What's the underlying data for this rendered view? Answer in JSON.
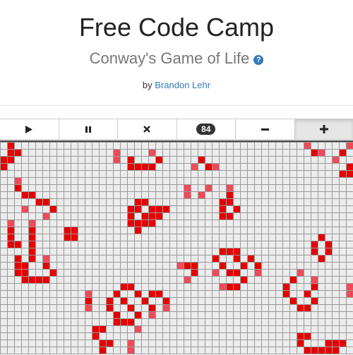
{
  "header": {
    "title": "Free Code Camp",
    "subtitle": "Conway's Game of Life",
    "help_icon": "question-circle-icon",
    "by_label": "by",
    "author": "Brandon Lehr"
  },
  "toolbar": {
    "play_icon": "play-icon",
    "pause_icon": "pause-icon",
    "clear_icon": "close-icon",
    "generation": "84",
    "slower_icon": "minus-icon",
    "faster_icon": "plus-icon"
  },
  "board": {
    "cols": 50,
    "rows": 30,
    "colors": {
      "empty": "#ececec",
      "grid": "#9a9a9a",
      "alive": "#e60000",
      "young": "#f04a5a"
    },
    "cells": [
      [
        1,
        0
      ],
      [
        1,
        1
      ],
      [
        2,
        1
      ],
      [
        0,
        2
      ],
      [
        1,
        2
      ],
      [
        0,
        3
      ],
      [
        16,
        1
      ],
      [
        16,
        2
      ],
      [
        21,
        1
      ],
      [
        18,
        2
      ],
      [
        22,
        2
      ],
      [
        18,
        3
      ],
      [
        19,
        3
      ],
      [
        20,
        3
      ],
      [
        21,
        3
      ],
      [
        28,
        2
      ],
      [
        29,
        3
      ],
      [
        27,
        3
      ],
      [
        30,
        3
      ],
      [
        43,
        0
      ],
      [
        44,
        1
      ],
      [
        45,
        1
      ],
      [
        49,
        0
      ],
      [
        48,
        1
      ],
      [
        47,
        2
      ],
      [
        48,
        4
      ],
      [
        49,
        4
      ],
      [
        49,
        3
      ],
      [
        2,
        5
      ],
      [
        2,
        6
      ],
      [
        3,
        7
      ],
      [
        4,
        7
      ],
      [
        5,
        8
      ],
      [
        6,
        8
      ],
      [
        3,
        9
      ],
      [
        7,
        9
      ],
      [
        6,
        10
      ],
      [
        26,
        6
      ],
      [
        26,
        7
      ],
      [
        29,
        6
      ],
      [
        28,
        7
      ],
      [
        32,
        6
      ],
      [
        32,
        7
      ],
      [
        32,
        8
      ],
      [
        31,
        8
      ],
      [
        31,
        9
      ],
      [
        32,
        10
      ],
      [
        31,
        10
      ],
      [
        33,
        9
      ],
      [
        19,
        8
      ],
      [
        20,
        8
      ],
      [
        18,
        9
      ],
      [
        19,
        9
      ],
      [
        21,
        9
      ],
      [
        22,
        9
      ],
      [
        23,
        9
      ],
      [
        18,
        10
      ],
      [
        20,
        10
      ],
      [
        21,
        10
      ],
      [
        22,
        10
      ],
      [
        19,
        11
      ],
      [
        20,
        11
      ],
      [
        21,
        11
      ],
      [
        19,
        12
      ],
      [
        18,
        11
      ],
      [
        1,
        11
      ],
      [
        1,
        12
      ],
      [
        1,
        13
      ],
      [
        1,
        14
      ],
      [
        4,
        11
      ],
      [
        4,
        12
      ],
      [
        4,
        13
      ],
      [
        4,
        14
      ],
      [
        2,
        14
      ],
      [
        9,
        12
      ],
      [
        10,
        12
      ],
      [
        9,
        13
      ],
      [
        10,
        13
      ],
      [
        4,
        15
      ],
      [
        4,
        16
      ],
      [
        2,
        16
      ],
      [
        2,
        17
      ],
      [
        3,
        17
      ],
      [
        2,
        18
      ],
      [
        3,
        18
      ],
      [
        6,
        16
      ],
      [
        6,
        17
      ],
      [
        7,
        18
      ],
      [
        6,
        19
      ],
      [
        5,
        19
      ],
      [
        4,
        19
      ],
      [
        3,
        19
      ],
      [
        31,
        15
      ],
      [
        32,
        15
      ],
      [
        33,
        15
      ],
      [
        30,
        16
      ],
      [
        33,
        16
      ],
      [
        35,
        16
      ],
      [
        31,
        17
      ],
      [
        34,
        17
      ],
      [
        36,
        17
      ],
      [
        36,
        18
      ],
      [
        30,
        18
      ],
      [
        32,
        18
      ],
      [
        33,
        18
      ],
      [
        34,
        19
      ],
      [
        31,
        20
      ],
      [
        32,
        20
      ],
      [
        33,
        20
      ],
      [
        25,
        17
      ],
      [
        26,
        17
      ],
      [
        27,
        17
      ],
      [
        27,
        18
      ],
      [
        26,
        19
      ],
      [
        45,
        13
      ],
      [
        44,
        14
      ],
      [
        46,
        14
      ],
      [
        44,
        15
      ],
      [
        46,
        15
      ],
      [
        45,
        16
      ],
      [
        42,
        18
      ],
      [
        41,
        19
      ],
      [
        44,
        19
      ],
      [
        40,
        20
      ],
      [
        44,
        20
      ],
      [
        40,
        21
      ],
      [
        43,
        21
      ],
      [
        41,
        22
      ],
      [
        44,
        22
      ],
      [
        42,
        23
      ],
      [
        43,
        23
      ],
      [
        49,
        20
      ],
      [
        49,
        21
      ],
      [
        12,
        21
      ],
      [
        12,
        22
      ],
      [
        12,
        23
      ],
      [
        17,
        20
      ],
      [
        18,
        20
      ],
      [
        16,
        21
      ],
      [
        19,
        21
      ],
      [
        21,
        21
      ],
      [
        22,
        21
      ],
      [
        15,
        22
      ],
      [
        17,
        22
      ],
      [
        20,
        22
      ],
      [
        23,
        22
      ],
      [
        15,
        23
      ],
      [
        18,
        23
      ],
      [
        21,
        23
      ],
      [
        23,
        23
      ],
      [
        16,
        24
      ],
      [
        19,
        24
      ],
      [
        21,
        24
      ],
      [
        16,
        25
      ],
      [
        17,
        25
      ],
      [
        18,
        25
      ],
      [
        14,
        26
      ],
      [
        13,
        26
      ],
      [
        19,
        26
      ],
      [
        13,
        27
      ],
      [
        14,
        28
      ],
      [
        15,
        28
      ],
      [
        14,
        29
      ],
      [
        18,
        28
      ],
      [
        18,
        29
      ],
      [
        42,
        27
      ],
      [
        43,
        27
      ],
      [
        42,
        28
      ],
      [
        43,
        29
      ],
      [
        44,
        29
      ],
      [
        45,
        29
      ],
      [
        46,
        29
      ],
      [
        47,
        29
      ],
      [
        46,
        28
      ],
      [
        47,
        28
      ],
      [
        48,
        28
      ]
    ]
  }
}
